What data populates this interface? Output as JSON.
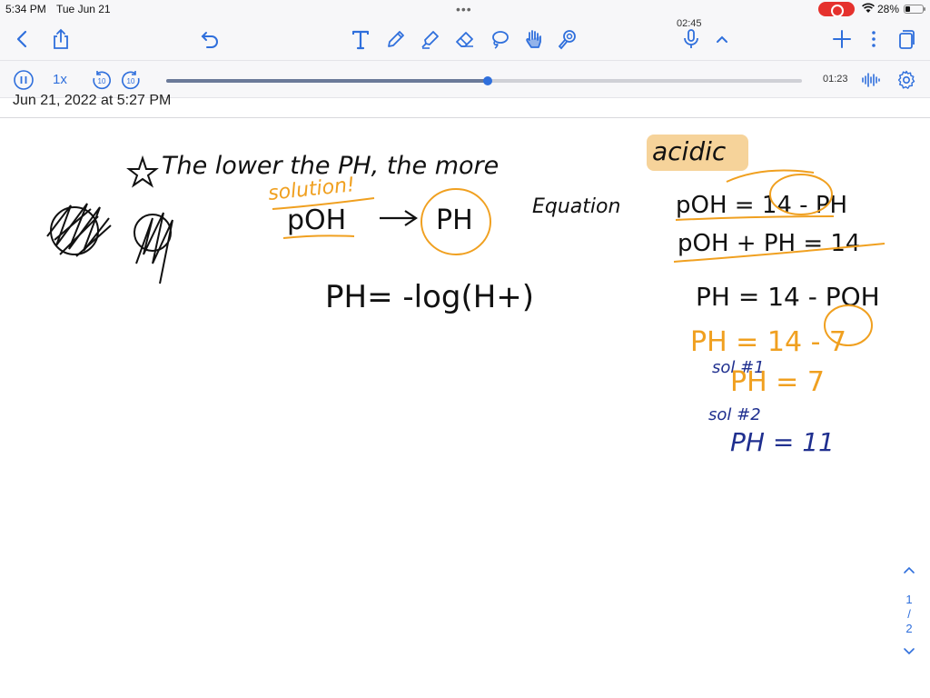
{
  "status_bar": {
    "time": "5:34 PM",
    "date": "Tue Jun 21",
    "battery": "28%"
  },
  "toolbar": {
    "recording_time": "02:45",
    "icons": [
      "back-icon",
      "share-icon",
      "undo-icon",
      "text-tool-icon",
      "pen-icon",
      "highlighter-icon",
      "eraser-icon",
      "lasso-icon",
      "hand-icon",
      "laser-pointer-icon",
      "microphone-icon",
      "chevron-up-icon",
      "add-icon",
      "more-icon",
      "pages-icon"
    ]
  },
  "audio": {
    "speed": "1x",
    "elapsed": "01:23",
    "skip_back": "10",
    "skip_forward": "10",
    "progress_fraction": 0.505
  },
  "note": {
    "date": "Jun 21, 2022 at 5:27 PM",
    "lines": {
      "intro": "The lower the PH, the more",
      "acidic": "acidic",
      "solution": "solution!",
      "poh": "pOH",
      "ph": "PH",
      "equation": "Equation",
      "ph_formula": "PH= -log(H+)",
      "eq1": "pOH = 14 - PH",
      "eq2": "pOH + PH = 14",
      "eq3": "PH = 14 - POH",
      "eq4": "PH = 14 - 7",
      "sol1": "sol #1",
      "eq5": "PH = 7",
      "sol2": "sol #2",
      "eq6": "PH = 11"
    },
    "colors": {
      "ink": "#111111",
      "orange": "#f0a020",
      "blue": "#1f2f8f",
      "highlight": "#f6d39a"
    }
  },
  "page_nav": {
    "current": "1",
    "separator": "/",
    "total": "2"
  }
}
